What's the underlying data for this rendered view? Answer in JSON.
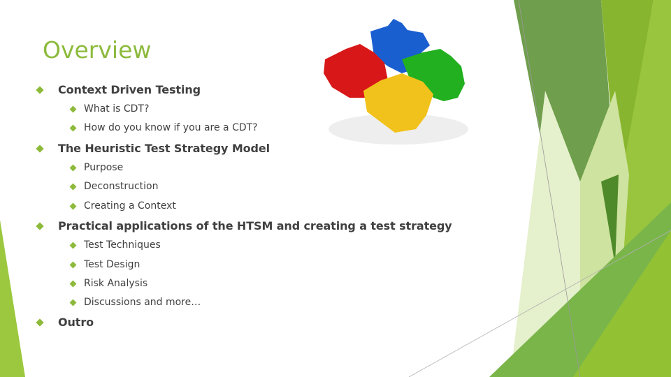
{
  "slide": {
    "title": "Overview",
    "image": "puzzle-pieces-icon",
    "accent_color": "#8cba3c",
    "bullets": [
      {
        "label": "Context Driven Testing",
        "children": [
          "What is CDT?",
          "How do you know if you are a CDT?"
        ]
      },
      {
        "label": "The Heuristic Test Strategy Model",
        "children": [
          "Purpose",
          "Deconstruction",
          "Creating a Context"
        ]
      },
      {
        "label": "Practical applications of the HTSM and creating a test strategy",
        "children": [
          "Test Techniques",
          "Test Design",
          "Risk Analysis",
          "Discussions and more…"
        ]
      },
      {
        "label": "Outro",
        "children": []
      }
    ]
  }
}
